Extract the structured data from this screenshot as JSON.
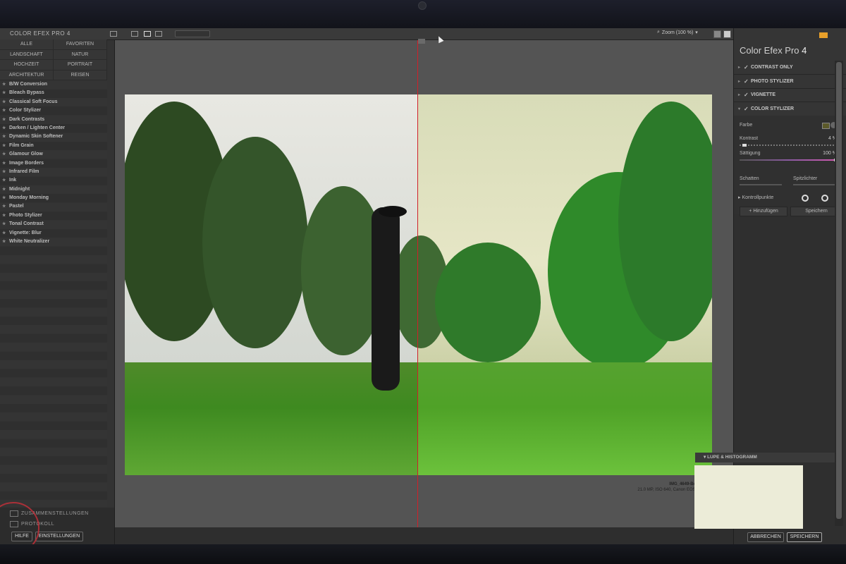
{
  "left_panel": {
    "app_title": "COLOR EFEX PRO 4",
    "categories": [
      {
        "label": "ALLE"
      },
      {
        "label": "FAVORITEN"
      },
      {
        "label": "LANDSCHAFT"
      },
      {
        "label": "NATUR"
      },
      {
        "label": "HOCHZEIT"
      },
      {
        "label": "PORTRAIT"
      },
      {
        "label": "ARCHITEKTUR"
      },
      {
        "label": "REISEN"
      }
    ],
    "filters": [
      {
        "label": "B/W Conversion"
      },
      {
        "label": "Bleach Bypass"
      },
      {
        "label": "Classical Soft Focus"
      },
      {
        "label": "Color Stylizer"
      },
      {
        "label": "Dark Contrasts"
      },
      {
        "label": "Darken / Lighten Center"
      },
      {
        "label": "Dynamic Skin Softener"
      },
      {
        "label": "Film Grain"
      },
      {
        "label": "Glamour Glow"
      },
      {
        "label": "Image Borders"
      },
      {
        "label": "Infrared Film"
      },
      {
        "label": "Ink"
      },
      {
        "label": "Midnight"
      },
      {
        "label": "Monday Morning"
      },
      {
        "label": "Pastel"
      },
      {
        "label": "Photo Stylizer"
      },
      {
        "label": "Tonal Contrast"
      },
      {
        "label": "Vignette: Blur"
      },
      {
        "label": "White Neutralizer"
      }
    ],
    "bottom": {
      "presets_label": "ZUSAMMENSTELLUNGEN",
      "history_label": "PROTOKOLL",
      "help_button": "HILFE",
      "settings_button": "EINSTELLUNGEN"
    }
  },
  "toolbar": {
    "zoom_label": "Zoom (100 %)"
  },
  "preview": {
    "filename": "IMG_4649-Bearbeitet.tif",
    "metadata": "21.0 MP, ISO 640, Canon EOS 5D Mark II"
  },
  "right_panel": {
    "title_main": "Color Efex Pro",
    "title_num": "4",
    "stack": [
      {
        "label": "CONTRAST ONLY",
        "expanded": false
      },
      {
        "label": "PHOTO STYLIZER",
        "expanded": false
      },
      {
        "label": "VIGNETTE",
        "expanded": false
      },
      {
        "label": "COLOR STYLIZER",
        "expanded": true
      }
    ],
    "options": {
      "farbe_label": "Farbe",
      "kontrast_label": "Kontrast",
      "kontrast_value": "4 %",
      "kontrast_level": 4,
      "saettigung_label": "Sättigung",
      "saettigung_value": "100 %",
      "saettigung_level": 100,
      "schatten_label": "Schatten",
      "spitzlichter_label": "Spitzlichter",
      "kontrollpunkte_label": "Kontrollpunkte",
      "add_button": "Hinzufügen",
      "save_button": "Speichern"
    },
    "histogram_label": "LUPE & HISTOGRAMM"
  },
  "footer": {
    "cancel_button": "ABBRECHEN",
    "save_button": "SPEICHERN"
  },
  "colors": {
    "divider": "#d0202a",
    "accent": "#e8a02a",
    "panel": "#333333"
  }
}
